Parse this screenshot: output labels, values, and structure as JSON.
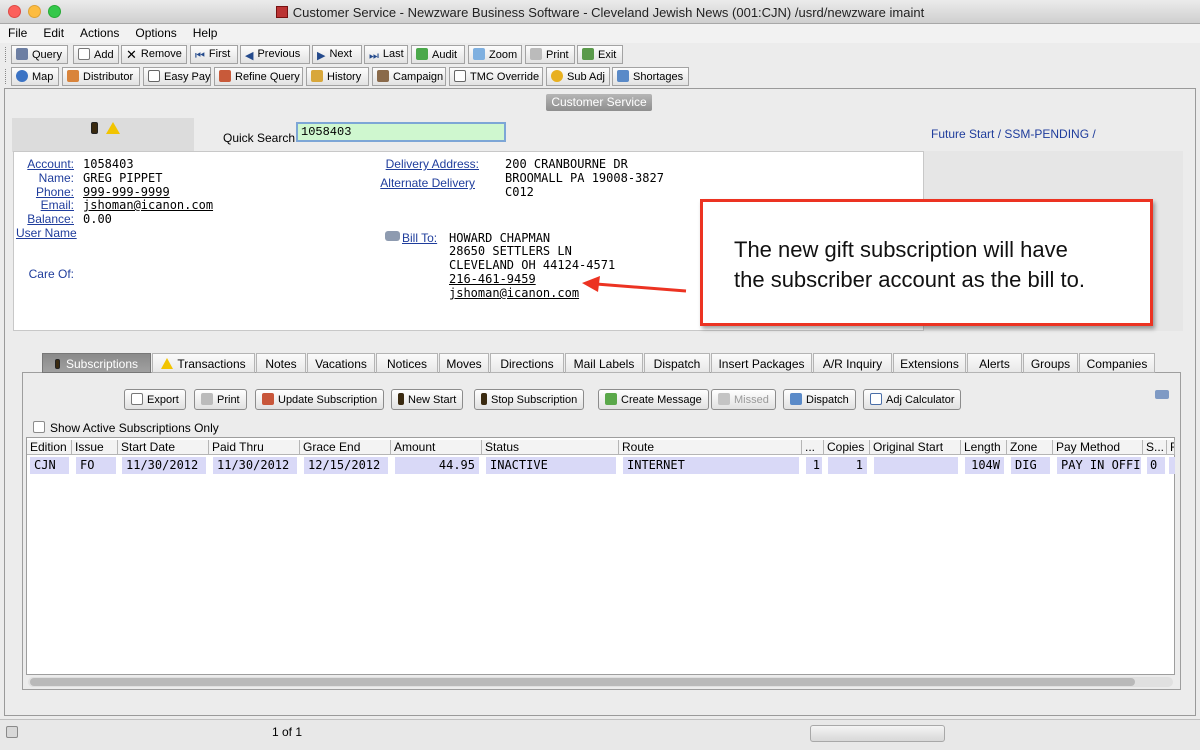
{
  "window": {
    "title": "Customer Service - Newzware Business Software - Cleveland Jewish News  (001:CJN)  /usrd/newzware  imaint"
  },
  "menu": [
    "File",
    "Edit",
    "Actions",
    "Options",
    "Help"
  ],
  "toolbar1": [
    "Query",
    "Add",
    "Remove",
    "First",
    "Previous",
    "Next",
    "Last",
    "Audit",
    "Zoom",
    "Print",
    "Exit"
  ],
  "toolbar2": [
    "Map",
    "Distributor",
    "Easy Pay",
    "Refine Query",
    "History",
    "Campaign",
    "TMC Override",
    "Sub Adj",
    "Shortages"
  ],
  "panel_title": "Customer Service",
  "quick_search": {
    "label": "Quick Search",
    "value": "1058403"
  },
  "future_start": "Future Start /  SSM-PENDING  /",
  "account": {
    "labels": {
      "account": "Account:",
      "name": "Name:",
      "phone": "Phone:",
      "email": "Email:",
      "balance": "Balance:",
      "user_name": "User Name",
      "care_of": "Care Of:",
      "delivery_address": "Delivery Address:",
      "alternate_delivery": "Alternate Delivery",
      "bill_to": "Bill To:"
    },
    "account_no": "1058403",
    "name": "GREG PIPPET",
    "phone": "999-999-9999",
    "email": "jshoman@icanon.com",
    "balance": "0.00",
    "delivery": [
      "200 CRANBOURNE DR",
      "BROOMALL PA 19008-3827",
      "C012"
    ],
    "bill_to": [
      "HOWARD CHAPMAN",
      "28650 SETTLERS LN",
      "CLEVELAND OH 44124-4571",
      "216-461-9459",
      "jshoman@icanon.com"
    ]
  },
  "callout": {
    "line1": "The new gift subscription will have",
    "line2": "the subscriber account as the bill to."
  },
  "tabs": [
    "Subscriptions",
    "Transactions",
    "Notes",
    "Vacations",
    "Notices",
    "Moves",
    "Directions",
    "Mail Labels",
    "Dispatch",
    "Insert Packages",
    "A/R Inquiry",
    "Extensions",
    "Alerts",
    "Groups",
    "Companies"
  ],
  "sub_buttons": [
    "Export",
    "Print",
    "Update Subscription",
    "New Start",
    "Stop Subscription",
    "Create Message",
    "Missed",
    "Dispatch",
    "Adj Calculator"
  ],
  "show_active_label": "Show Active Subscriptions Only",
  "grid": {
    "columns": [
      "Edition",
      "Issue",
      "Start Date",
      "Paid Thru",
      "Grace End",
      "Amount",
      "Status",
      "Route",
      "...",
      "Copies",
      "Original Start",
      "Length",
      "Zone",
      "Pay Method",
      "S...",
      "F"
    ],
    "rows": [
      [
        "CJN",
        "FO",
        "11/30/2012",
        "11/30/2012",
        "12/15/2012",
        "44.95",
        "INACTIVE",
        "INTERNET",
        "1",
        "1",
        "",
        "104W",
        "DIG",
        "PAY IN OFFICE",
        "0",
        ""
      ]
    ]
  },
  "status_bar": {
    "page": "1 of 1"
  },
  "colors": {
    "link": "#1f3d9c",
    "callout_border": "#ec3322",
    "arrow": "#ec3322",
    "row_highlight": "#d9d9f7",
    "search_bg": "#cff7cf"
  }
}
